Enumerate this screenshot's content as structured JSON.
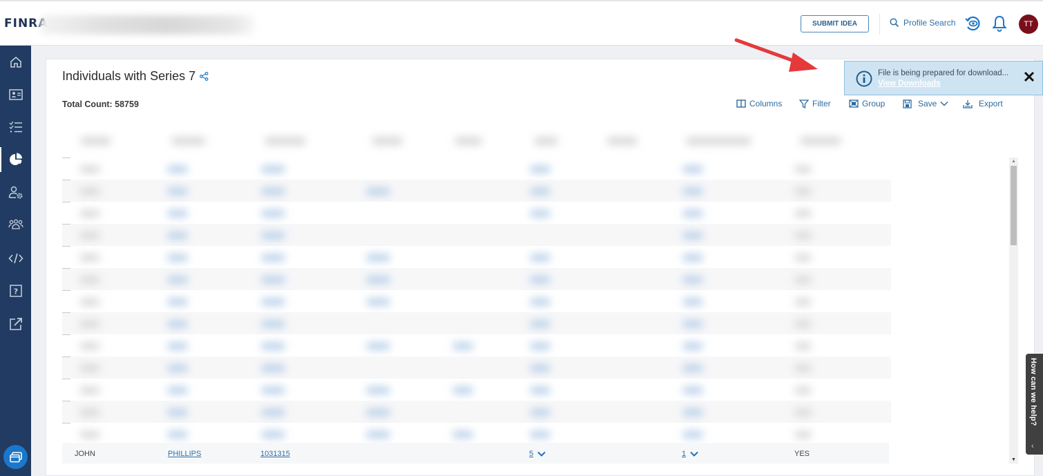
{
  "header": {
    "logo": "FINRA",
    "app_title_redacted": true,
    "submit_idea_label": "SUBMIT IDEA",
    "profile_search_label": "Profile Search",
    "avatar_initials": "TT",
    "icons": [
      "search-icon",
      "recent-views-icon",
      "bell-icon"
    ]
  },
  "sidebar": {
    "items": [
      {
        "name": "home",
        "icon": "home-icon",
        "active": false
      },
      {
        "name": "profile-card",
        "icon": "id-card-icon",
        "active": false
      },
      {
        "name": "tasks",
        "icon": "checklist-icon",
        "active": false
      },
      {
        "name": "reports",
        "icon": "pie-chart-icon",
        "active": true
      },
      {
        "name": "user-admin",
        "icon": "user-gear-icon",
        "active": false
      },
      {
        "name": "groups",
        "icon": "users-icon",
        "active": false
      },
      {
        "name": "developer",
        "icon": "code-icon",
        "active": false
      },
      {
        "name": "help",
        "icon": "question-icon",
        "active": false
      },
      {
        "name": "external",
        "icon": "external-link-icon",
        "active": false
      }
    ],
    "fab_icon": "windows-icon"
  },
  "page": {
    "title": "Individuals with Series 7",
    "total_count_label": "Total Count: 58759"
  },
  "toolbar": {
    "columns": "Columns",
    "filter": "Filter",
    "group": "Group",
    "save": "Save",
    "export": "Export"
  },
  "toast": {
    "message": "File is being prepared for download...",
    "link": "View Downloads",
    "close": "×"
  },
  "grid": {
    "redacted": true,
    "visible_last_row": {
      "first_name": "JOHN",
      "last_name": "PHILLIPS",
      "crd": "1031315",
      "count_a": "5",
      "count_b": "1",
      "flag": "YES"
    }
  },
  "help_widget": {
    "label": "How can we help?"
  }
}
